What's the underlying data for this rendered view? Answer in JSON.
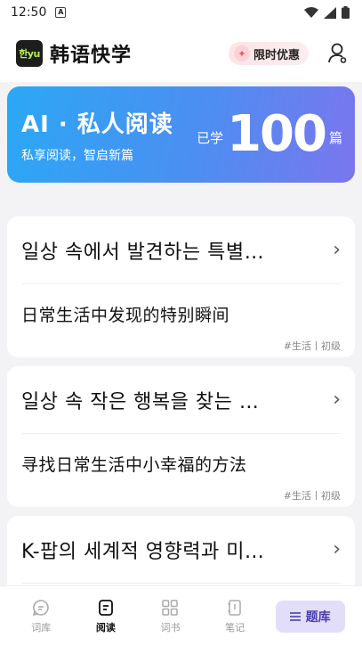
{
  "status": {
    "time": "12:50",
    "sim_label": "A"
  },
  "header": {
    "logo_text": "한yu",
    "title": "韩语快学",
    "promo_label": "限时优惠"
  },
  "banner": {
    "title": "AI · 私人阅读",
    "subtitle": "私享阅读，智启新篇",
    "prefix": "已学",
    "count": "100",
    "unit": "篇"
  },
  "articles": [
    {
      "title": "일상 속에서 발견하는 특별…",
      "translation": "日常生活中发现的特别瞬间",
      "tags": "#生活丨初级"
    },
    {
      "title": "일상 속 작은 행복을 찾는 …",
      "translation": "寻找日常生活中小幸福的方法",
      "tags": "#生活丨初级"
    },
    {
      "title": "K-팝의 세계적 영향력과 미…",
      "translation": "",
      "tags": ""
    }
  ],
  "tabs": [
    {
      "label": "词库",
      "icon": "chat-icon"
    },
    {
      "label": "阅读",
      "icon": "document-icon"
    },
    {
      "label": "词书",
      "icon": "grid-icon"
    },
    {
      "label": "笔记",
      "icon": "notebook-icon"
    }
  ],
  "question_bank": {
    "label": "题库",
    "icon": "menu-icon"
  },
  "colors": {
    "banner_start": "#2ba8f5",
    "banner_end": "#7b76ee",
    "question_bank_bg": "#e2defa"
  }
}
